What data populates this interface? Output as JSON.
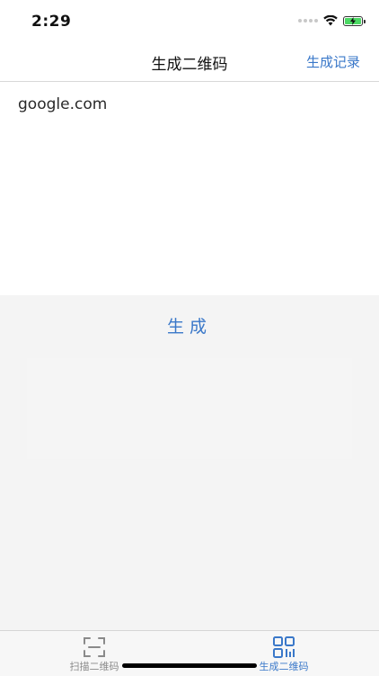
{
  "status_bar": {
    "time": "2:29",
    "signal_icon": "signal-dots-icon",
    "wifi_icon": "wifi-icon",
    "battery_icon": "battery-charging-icon",
    "battery_color": "#4cd964"
  },
  "nav": {
    "title": "生成二维码",
    "right_button_label": "生成记录"
  },
  "input": {
    "value": "google.com"
  },
  "actions": {
    "generate_label": "生成"
  },
  "tab_bar": {
    "items": [
      {
        "label": "扫描二维码",
        "icon": "scan-frame-icon",
        "active": false
      },
      {
        "label": "生成二维码",
        "icon": "qr-code-icon",
        "active": true
      }
    ]
  },
  "colors": {
    "accent": "#3a78c9",
    "inactive_tab": "#8a8a8a",
    "background": "#f4f4f4"
  }
}
